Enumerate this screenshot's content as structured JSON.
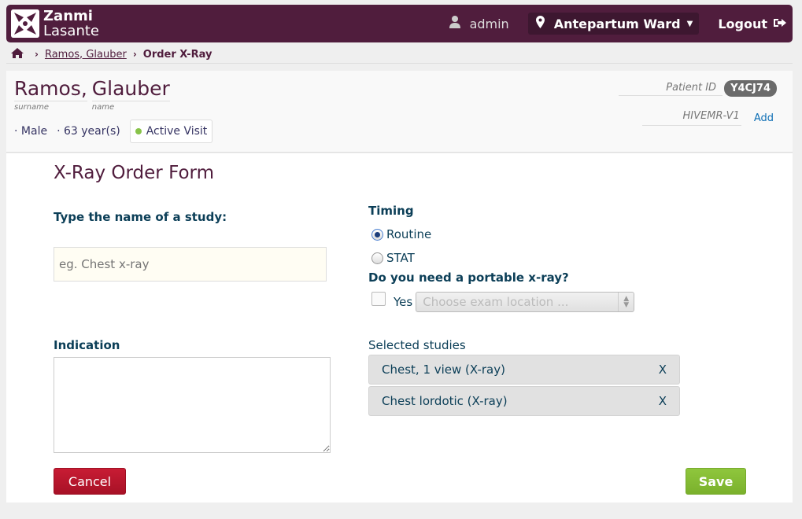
{
  "header": {
    "logo_line1": "Zanmi",
    "logo_line2": "Lasante",
    "user": "admin",
    "location": "Antepartum Ward",
    "logout": "Logout"
  },
  "breadcrumb": {
    "patient": "Ramos, Glauber",
    "current": "Order X-Ray"
  },
  "patient": {
    "surname": "Ramos,",
    "name": "Glauber",
    "surname_label": "surname",
    "name_label": "name",
    "gender": "Male",
    "age": "63 year(s)",
    "visit_status": "Active Visit",
    "patient_id_label": "Patient ID",
    "patient_id": "Y4CJ74",
    "hiv_label": "HIVEMR-V1",
    "add_label": "Add"
  },
  "form": {
    "title": "X-Ray Order Form",
    "study_label": "Type the name of a study:",
    "study_placeholder": "eg. Chest x-ray",
    "timing_label": "Timing",
    "timing_options": [
      "Routine",
      "STAT"
    ],
    "timing_selected": "Routine",
    "portable_label": "Do you need a portable x-ray?",
    "portable_yes": "Yes",
    "location_placeholder": "Choose exam location ...",
    "indication_label": "Indication",
    "selected_label": "Selected studies",
    "selected_studies": [
      {
        "name": "Chest, 1 view (X-ray)",
        "remove": "X"
      },
      {
        "name": "Chest lordotic (X-ray)",
        "remove": "X"
      }
    ],
    "cancel": "Cancel",
    "save": "Save"
  },
  "colors": {
    "brand": "#501d3d",
    "cancel": "#b8172c",
    "save": "#84bc33",
    "active": "#88c34a"
  }
}
